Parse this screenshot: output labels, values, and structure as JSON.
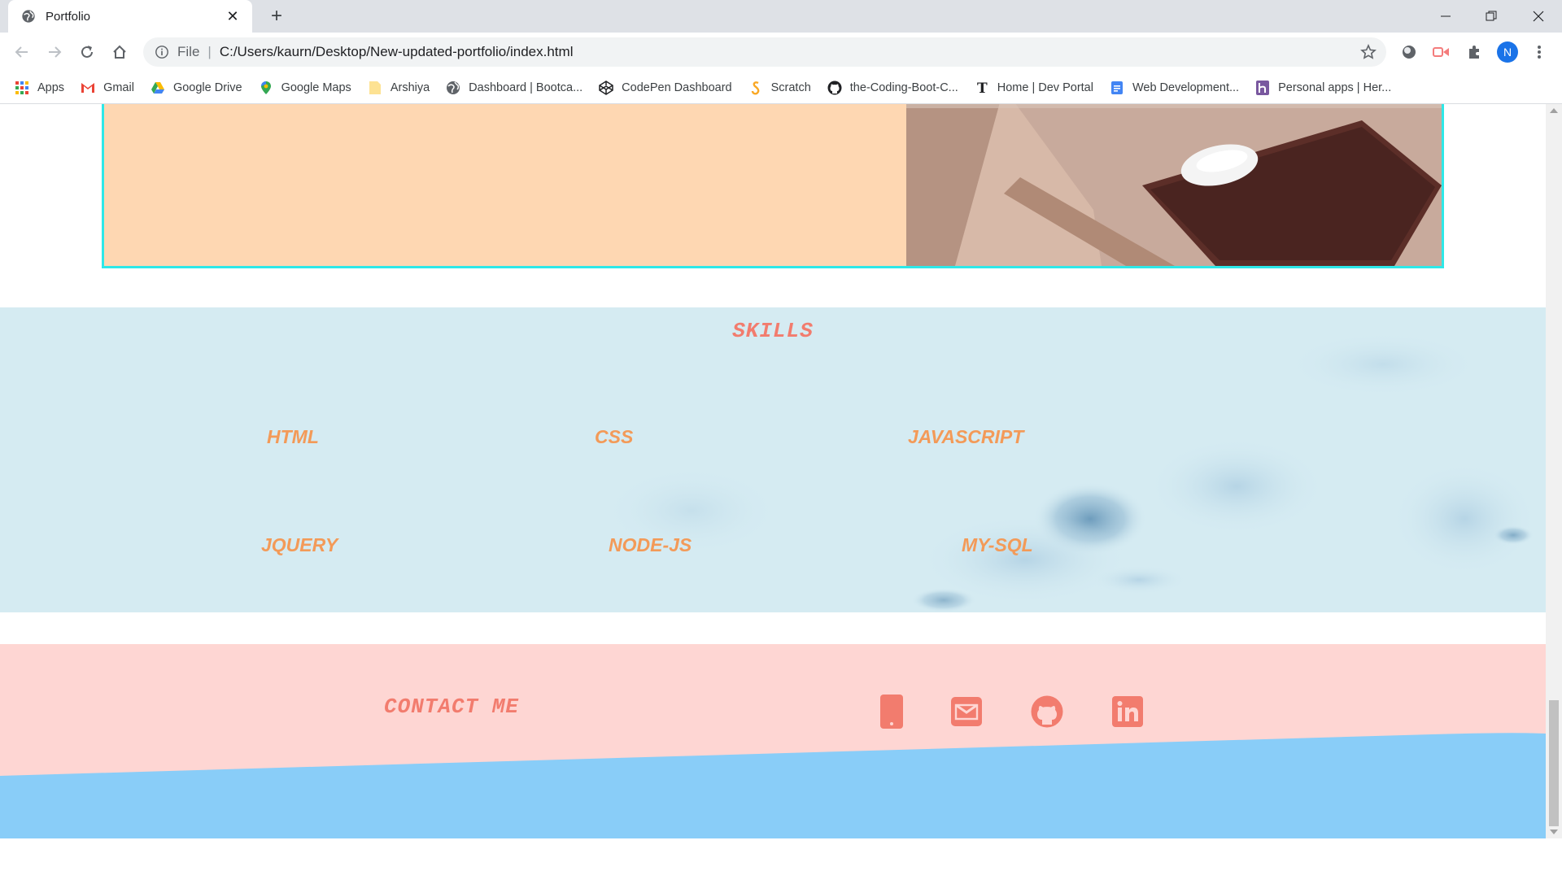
{
  "browser": {
    "tab_title": "Portfolio",
    "url_scheme": "File",
    "url": "C:/Users/kaurn/Desktop/New-updated-portfolio/index.html",
    "profile_initial": "N",
    "bookmarks": [
      {
        "label": "Apps",
        "icon": "apps-grid-icon"
      },
      {
        "label": "Gmail",
        "icon": "gmail-icon"
      },
      {
        "label": "Google Drive",
        "icon": "google-drive-icon"
      },
      {
        "label": "Google Maps",
        "icon": "google-maps-icon"
      },
      {
        "label": "Arshiya",
        "icon": "folder-icon"
      },
      {
        "label": "Dashboard | Bootca...",
        "icon": "globe-icon"
      },
      {
        "label": "CodePen Dashboard",
        "icon": "codepen-icon"
      },
      {
        "label": "Scratch",
        "icon": "scratch-icon"
      },
      {
        "label": "the-Coding-Boot-C...",
        "icon": "github-icon"
      },
      {
        "label": "Home | Dev Portal",
        "icon": "nyt-icon"
      },
      {
        "label": "Web Development...",
        "icon": "docs-icon"
      },
      {
        "label": "Personal apps | Her...",
        "icon": "heroku-icon"
      }
    ]
  },
  "skills": {
    "title": "SKILLS",
    "items": [
      "HTML",
      "CSS",
      "JAVASCRIPT",
      "JQUERY",
      "NODE-JS",
      "MY-SQL"
    ]
  },
  "contact": {
    "title": "CONTACT  ME",
    "icons": [
      "phone-icon",
      "email-icon",
      "github-icon",
      "linkedin-icon"
    ]
  },
  "colors": {
    "accent": "#f27c6e",
    "skill_text": "#f39a58",
    "card_border": "#2ee8e8",
    "card_bg": "#fed7b2",
    "skills_bg": "#d5ebf2",
    "contact_bg": "#fed6d3",
    "wave": "#89cdf8"
  }
}
